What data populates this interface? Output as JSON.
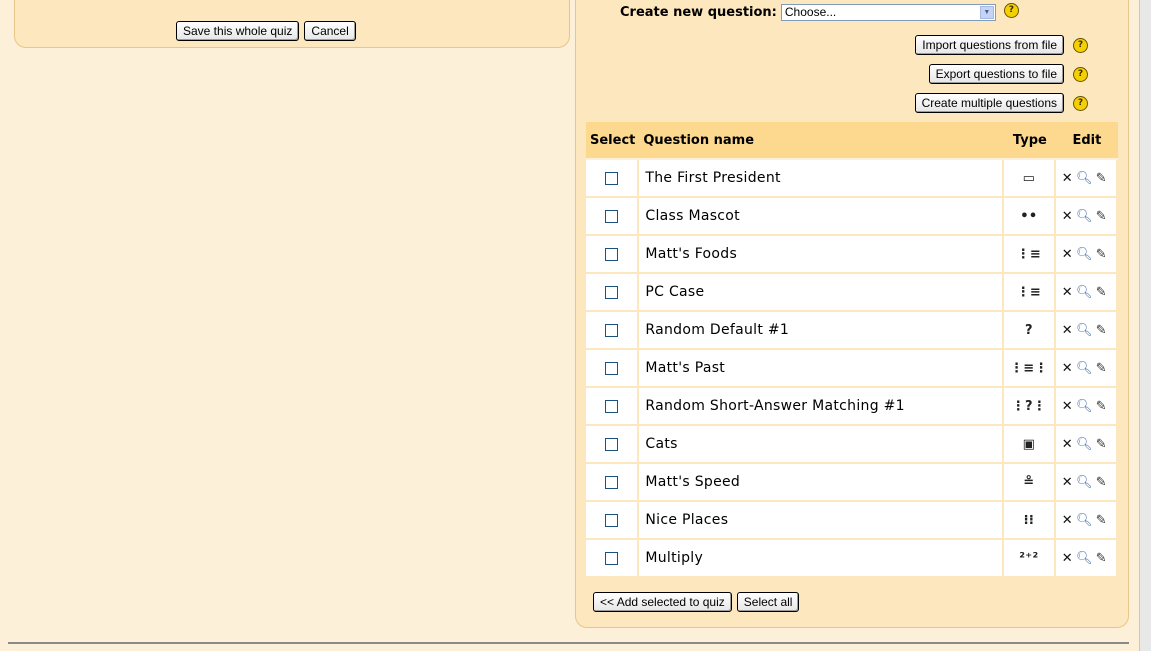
{
  "left": {
    "save_label": "Save this whole quiz",
    "cancel_label": "Cancel"
  },
  "create": {
    "label": "Create new question:",
    "selected": "Choose...",
    "help": "?"
  },
  "actions": {
    "import_label": "Import questions from file",
    "export_label": "Export questions to file",
    "multiple_label": "Create multiple questions"
  },
  "table": {
    "headers": {
      "select": "Select",
      "name": "Question name",
      "type": "Type",
      "edit": "Edit"
    },
    "rows": [
      {
        "name": "The First President",
        "type_icon": "short-answer-icon",
        "type_glyph": "▭"
      },
      {
        "name": "Class Mascot",
        "type_icon": "true-false-icon",
        "type_glyph": "••"
      },
      {
        "name": "Matt's Foods",
        "type_icon": "multiple-choice-icon",
        "type_glyph": "⋮≡"
      },
      {
        "name": "PC Case",
        "type_icon": "multiple-choice-icon",
        "type_glyph": "⋮≡"
      },
      {
        "name": "Random Default #1",
        "type_icon": "random-icon",
        "type_glyph": "?"
      },
      {
        "name": "Matt's Past",
        "type_icon": "matching-icon",
        "type_glyph": "⋮≡⋮"
      },
      {
        "name": "Random Short-Answer Matching #1",
        "type_icon": "random-matching-icon",
        "type_glyph": "⋮?⋮"
      },
      {
        "name": "Cats",
        "type_icon": "description-icon",
        "type_glyph": "▣"
      },
      {
        "name": "Matt's Speed",
        "type_icon": "numerical-icon",
        "type_glyph": "≗"
      },
      {
        "name": "Nice Places",
        "type_icon": "cloze-icon",
        "type_glyph": "⁝⁝"
      },
      {
        "name": "Multiply",
        "type_icon": "calculated-icon",
        "type_glyph": "²⁺²"
      }
    ]
  },
  "bottom": {
    "add_label": "<< Add selected to quiz",
    "select_all_label": "Select all"
  },
  "colors": {
    "page_bg": "#fdf0d8",
    "panel_bg": "#fde7be",
    "header_bg": "#fdd98f"
  }
}
